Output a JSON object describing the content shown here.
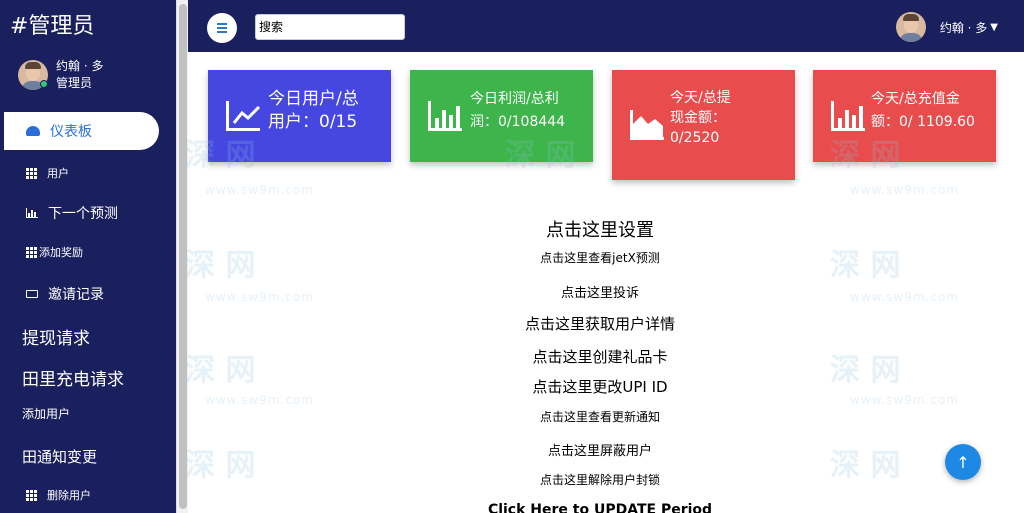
{
  "sidebar": {
    "brand": "#管理员",
    "user_name": "约翰 · 多",
    "user_role": "管理员",
    "active_item": "仪表板",
    "items": [
      {
        "label": "用户",
        "icon": "grid-icon"
      },
      {
        "label": "下一个预测",
        "icon": "bar-chart-icon"
      },
      {
        "label": "添加奖励",
        "icon": "grid-icon"
      },
      {
        "label": "邀请记录",
        "icon": "keyboard-icon"
      }
    ],
    "sections": [
      "提现请求",
      "田里充电请求",
      "添加用户",
      "田通知变更"
    ],
    "bottom_item": "删除用户"
  },
  "topbar": {
    "search_placeholder": "搜索",
    "user_name": "约翰 · 多"
  },
  "cards": [
    {
      "line1": "今日用户/总",
      "line2": "用户：0/15",
      "color": "#4547e0",
      "icon": "line-chart-icon"
    },
    {
      "line1": "今日利润/总利",
      "line2": "润：0/108444",
      "color": "#3db54a",
      "icon": "bar-chart-icon"
    },
    {
      "line1": "今天/总提",
      "line2": "现金额：",
      "line3": "0/2520",
      "color": "#e84c4c",
      "icon": "area-chart-icon"
    },
    {
      "line1": "今天/总充值金",
      "line2": "额：0/ 1109.60",
      "color": "#e84c4c",
      "icon": "bar-chart-icon"
    }
  ],
  "links": [
    "点击这里设置",
    "点击这里查看jetX预测",
    "点击这里投诉",
    "点击这里获取用户详情",
    "点击这里创建礼品卡",
    "点击这里更改UPI ID",
    "点击这里查看更新通知",
    "点击这里屏蔽用户",
    "点击这里解除用户封锁",
    "Click Here to UPDATE Period"
  ],
  "watermark": {
    "big": "深 网",
    "small": "www.sw9m.com"
  },
  "fab_label": "↑",
  "colors": {
    "sidebar": "#1a1f5e",
    "accent": "#2a6fd8"
  }
}
